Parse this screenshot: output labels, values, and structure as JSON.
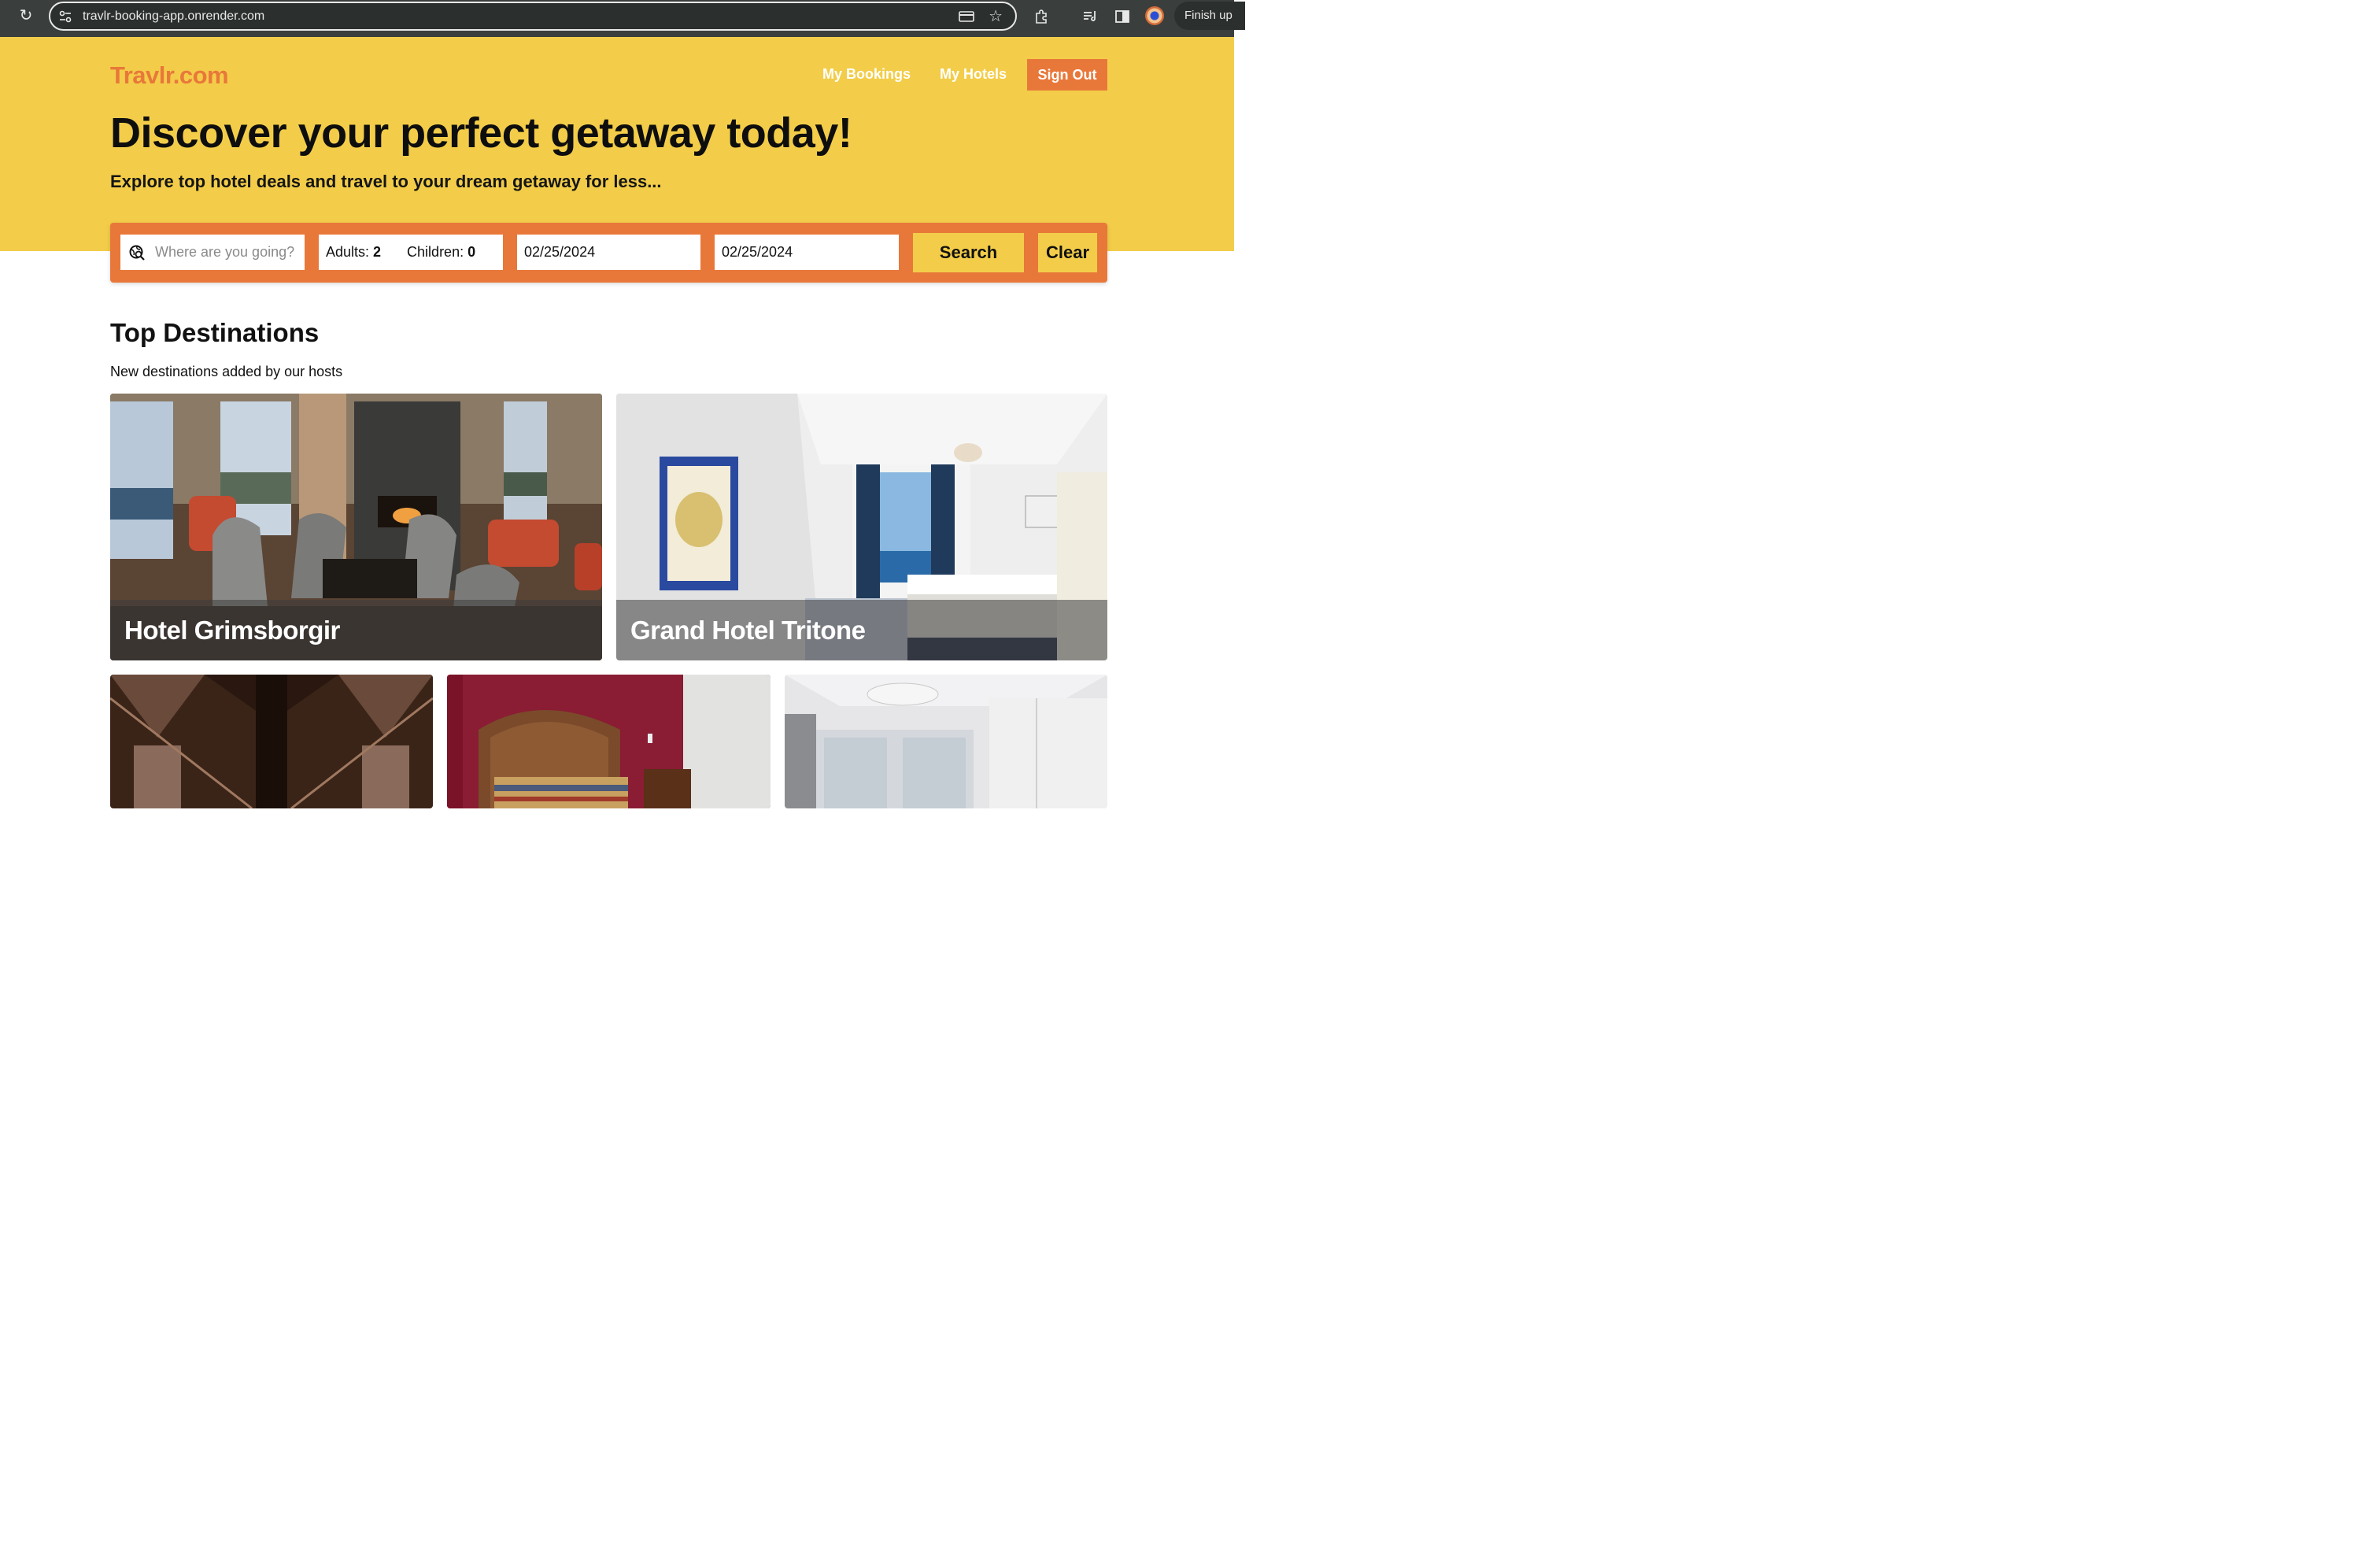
{
  "browser": {
    "url": "travlr-booking-app.onrender.com",
    "profile_button": "Finish up"
  },
  "header": {
    "logo": "Travlr.com",
    "nav": {
      "my_bookings": "My Bookings",
      "my_hotels": "My Hotels",
      "sign_out": "Sign Out"
    }
  },
  "hero": {
    "title": "Discover your perfect getaway today!",
    "subtitle": "Explore top hotel deals and travel to your dream getaway for less..."
  },
  "search": {
    "destination_placeholder": "Where are you going?",
    "adults_label": "Adults:",
    "adults_value": "2",
    "children_label": "Children:",
    "children_value": "0",
    "check_in": "02/25/2024",
    "check_out": "02/25/2024",
    "search_label": "Search",
    "clear_label": "Clear"
  },
  "destinations": {
    "title": "Top Destinations",
    "subtitle": "New destinations added by our hosts",
    "hotels": [
      {
        "name": "Hotel Grimsborgir"
      },
      {
        "name": "Grand Hotel Tritone"
      },
      {
        "name": ""
      },
      {
        "name": ""
      },
      {
        "name": ""
      }
    ]
  },
  "colors": {
    "brand_yellow": "#f3cd49",
    "brand_orange": "#e8783a",
    "chrome_dark": "#3a3f3d"
  }
}
